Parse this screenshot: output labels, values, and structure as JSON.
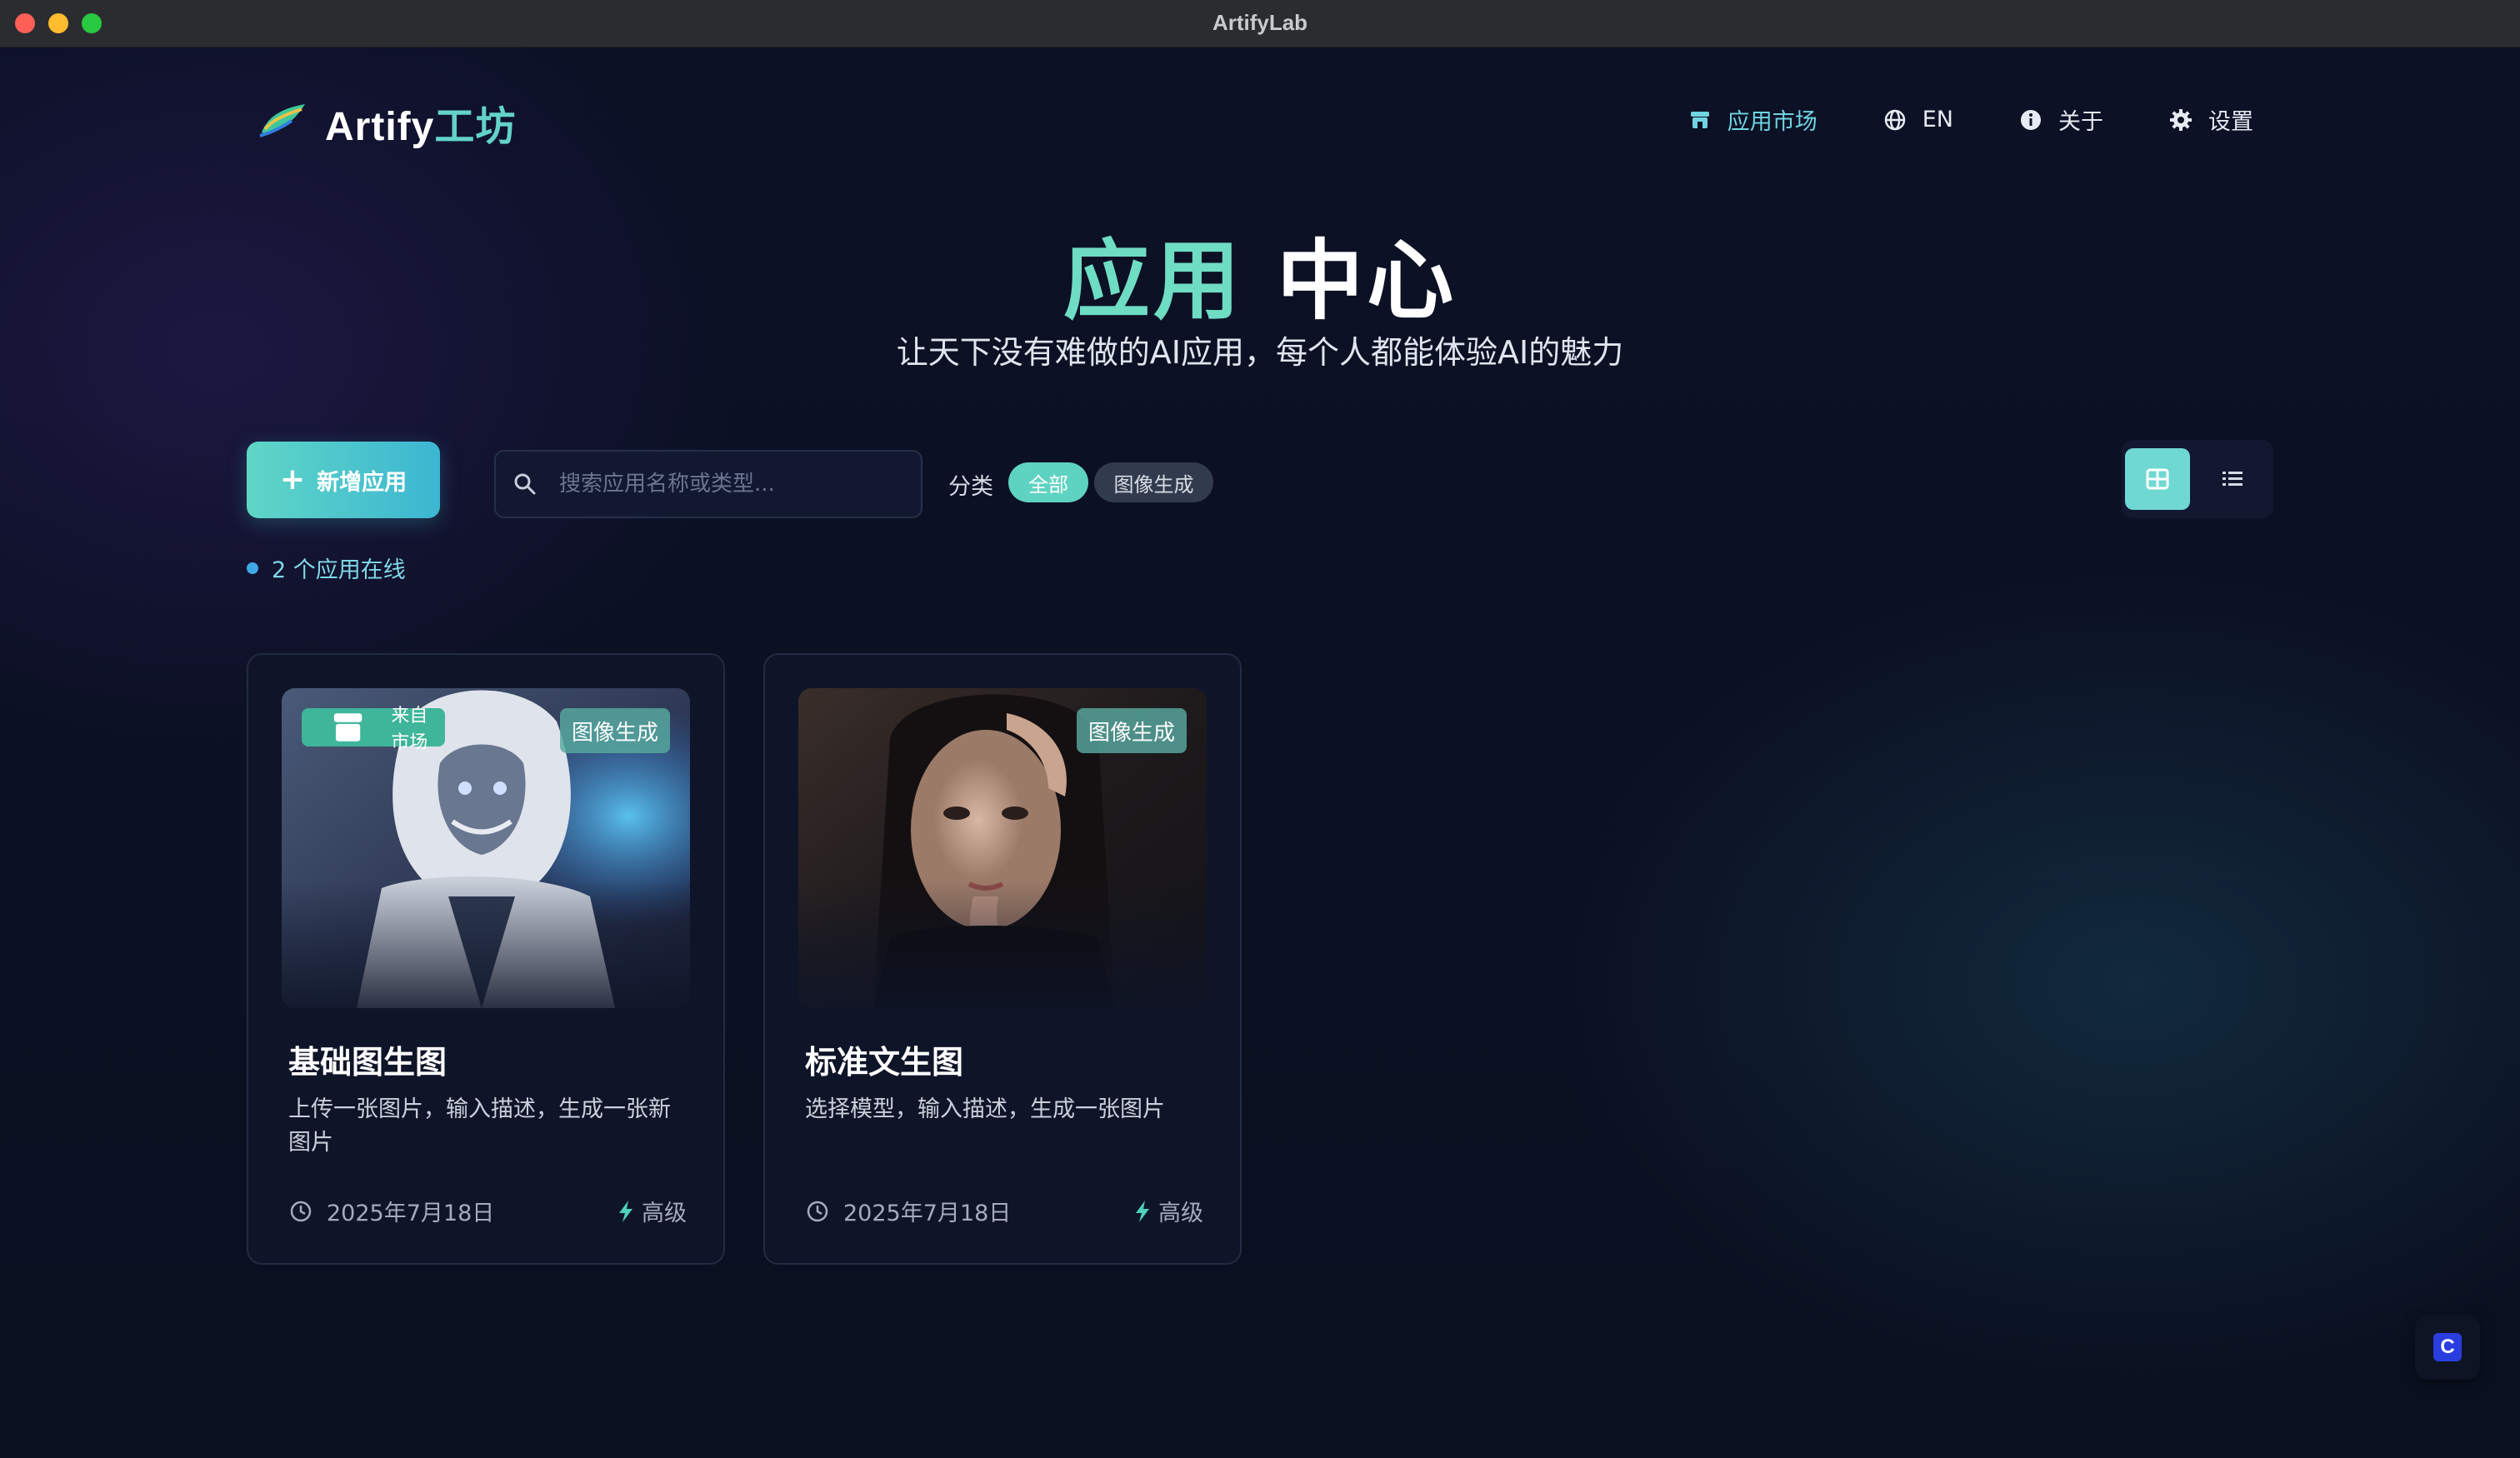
{
  "window": {
    "title": "ArtifyLab"
  },
  "brand": {
    "logo_en": "Artify",
    "logo_zh": "工坊",
    "accent": "#63d2c9"
  },
  "nav": {
    "items": [
      {
        "label": "应用市场",
        "icon": "store-icon",
        "active": true
      },
      {
        "label": "EN",
        "icon": "globe-icon"
      },
      {
        "label": "关于",
        "icon": "info-icon"
      },
      {
        "label": "设置",
        "icon": "gear-icon"
      }
    ]
  },
  "hero": {
    "title_a": "应用",
    "title_b": "中心",
    "subtitle": "让天下没有难做的AI应用，每个人都能体验AI的魅力"
  },
  "toolbar": {
    "add_label": "新增应用",
    "search_placeholder": "搜索应用名称或类型...",
    "category_label": "分类",
    "categories": [
      {
        "label": "全部",
        "selected": true
      },
      {
        "label": "图像生成",
        "selected": false
      }
    ],
    "view_mode": "grid"
  },
  "status": {
    "online_text": "2 个应用在线"
  },
  "apps": [
    {
      "name": "基础图生图",
      "description": "上传一张图片，输入描述，生成一张新图片",
      "type_badge": "图像生成",
      "source_badge": "来自市场",
      "date": "2025年7月18日",
      "level": "高级"
    },
    {
      "name": "标准文生图",
      "description": "选择模型，输入描述，生成一张图片",
      "type_badge": "图像生成",
      "date": "2025年7月18日",
      "level": "高级"
    }
  ],
  "floating": {
    "icon": "chat-logo-icon",
    "glyph": "C"
  }
}
